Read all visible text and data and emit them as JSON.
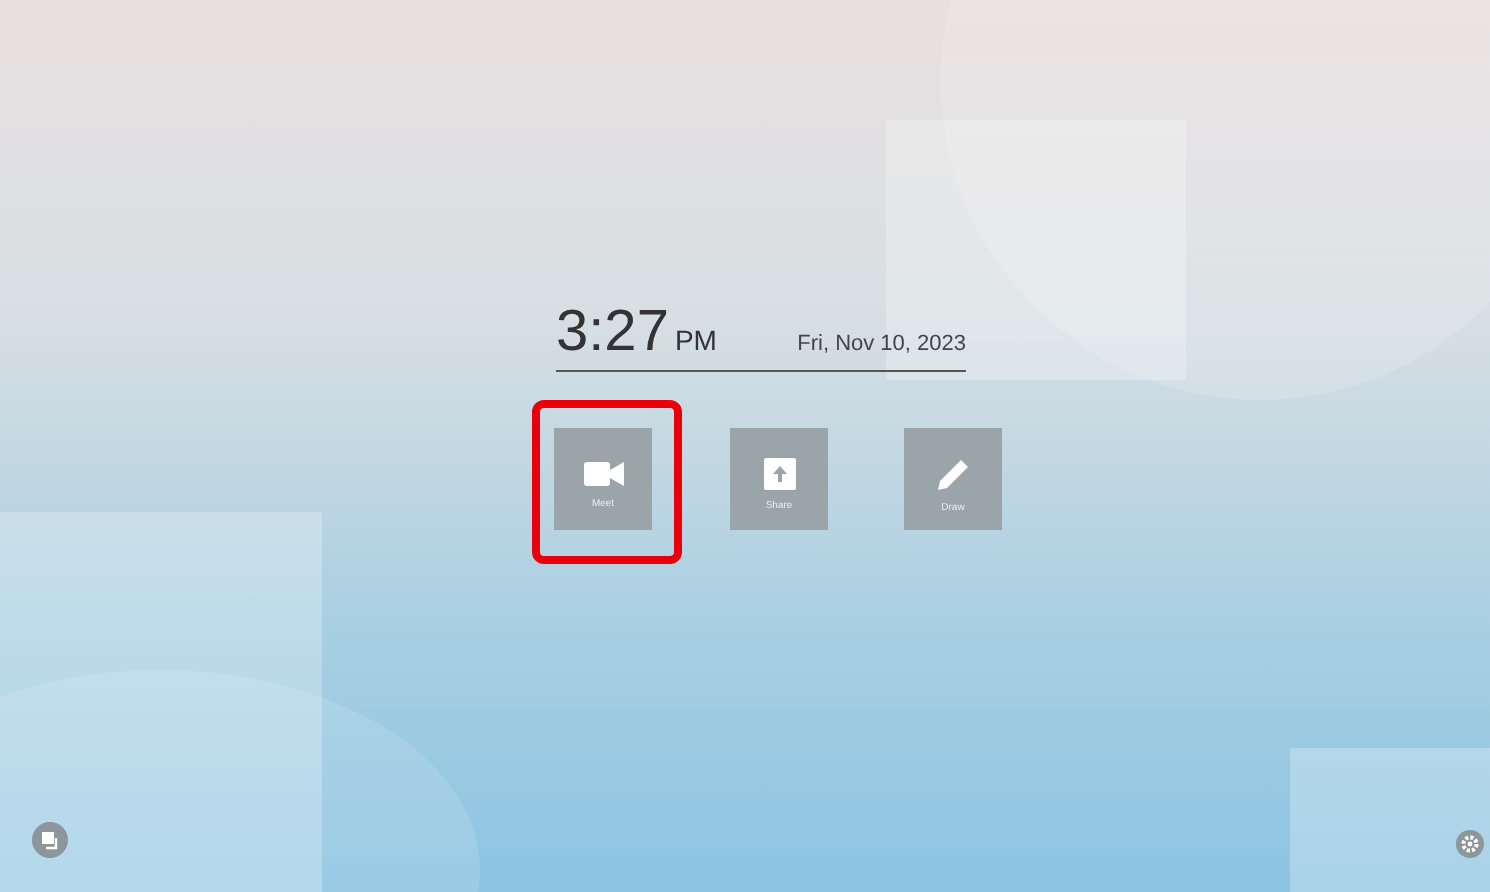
{
  "clock": {
    "time": "3:27",
    "meridiem": "PM",
    "date": "Fri, Nov 10, 2023"
  },
  "tiles": [
    {
      "kind": "meet",
      "label": "Meet",
      "selected": true
    },
    {
      "kind": "share",
      "label": "Share",
      "selected": false
    },
    {
      "kind": "draw",
      "label": "Draw",
      "selected": false
    }
  ]
}
